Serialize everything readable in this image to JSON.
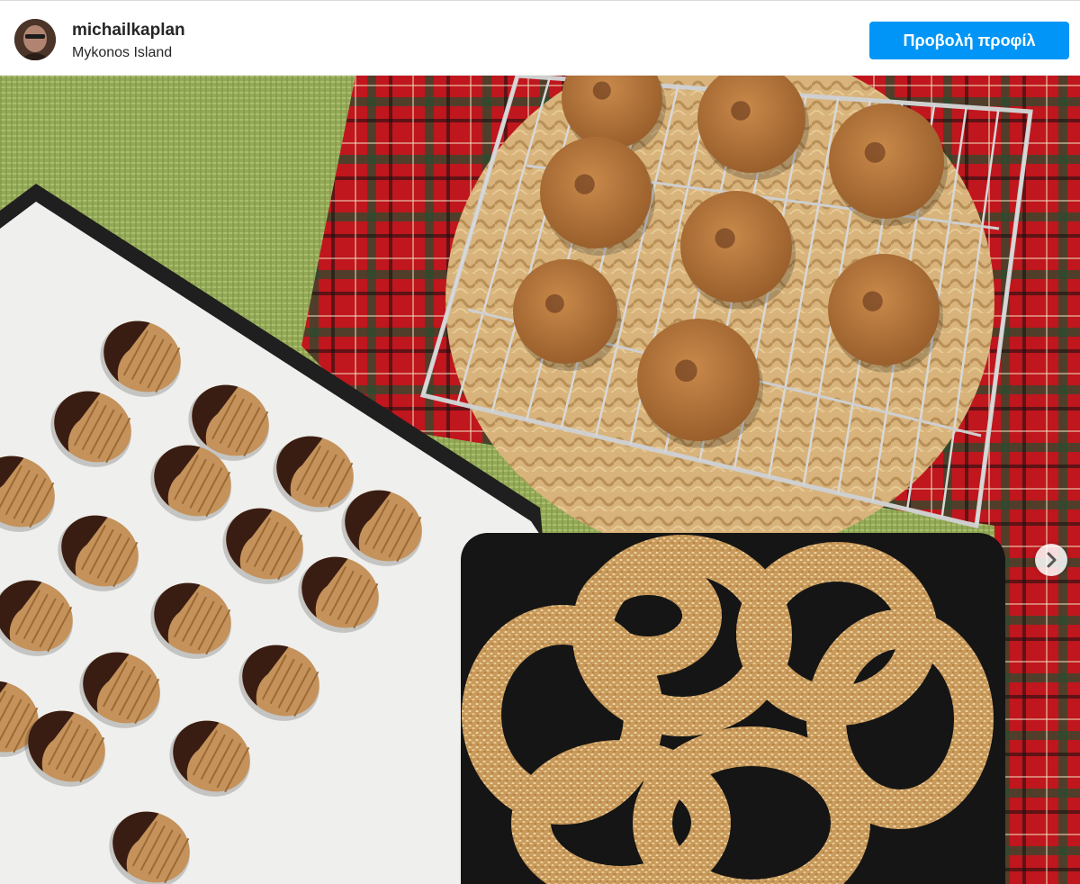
{
  "post": {
    "username": "michailkaplan",
    "location": "Mykonos Island",
    "view_profile_label": "Προβολή προφίλ"
  },
  "colors": {
    "button_blue": "#0095f6",
    "plaid_red": "#b8141c",
    "placemat_green": "#9cb15b",
    "tray_black": "#1a1a1a"
  },
  "icons": {
    "next": "chevron-right-icon"
  }
}
